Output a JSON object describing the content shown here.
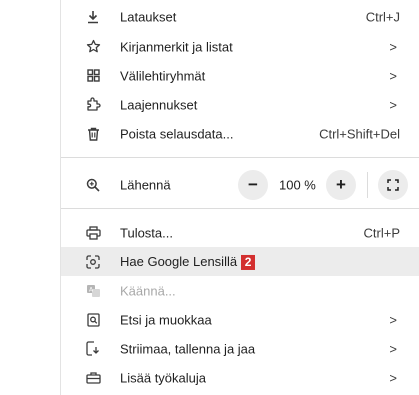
{
  "menu": {
    "downloads": {
      "label": "Lataukset",
      "shortcut": "Ctrl+J"
    },
    "bookmarks": {
      "label": "Kirjanmerkit ja listat",
      "arrow": ">"
    },
    "tab_groups": {
      "label": "Välilehtiryhmät",
      "arrow": ">"
    },
    "extensions": {
      "label": "Laajennukset",
      "arrow": ">"
    },
    "clear_data": {
      "label": "Poista selausdata...",
      "shortcut": "Ctrl+Shift+Del"
    },
    "zoom": {
      "label": "Lähennä",
      "minus": "−",
      "value": "100 %",
      "plus": "+"
    },
    "print": {
      "label": "Tulosta...",
      "shortcut": "Ctrl+P"
    },
    "lens": {
      "label": "Hae Google Lensillä",
      "badge": "2"
    },
    "translate": {
      "label": "Käännä..."
    },
    "find_edit": {
      "label": "Etsi ja muokkaa",
      "arrow": ">"
    },
    "cast_save": {
      "label": "Striimaa, tallenna ja jaa",
      "arrow": ">"
    },
    "more_tools": {
      "label": "Lisää työkaluja",
      "arrow": ">"
    }
  }
}
